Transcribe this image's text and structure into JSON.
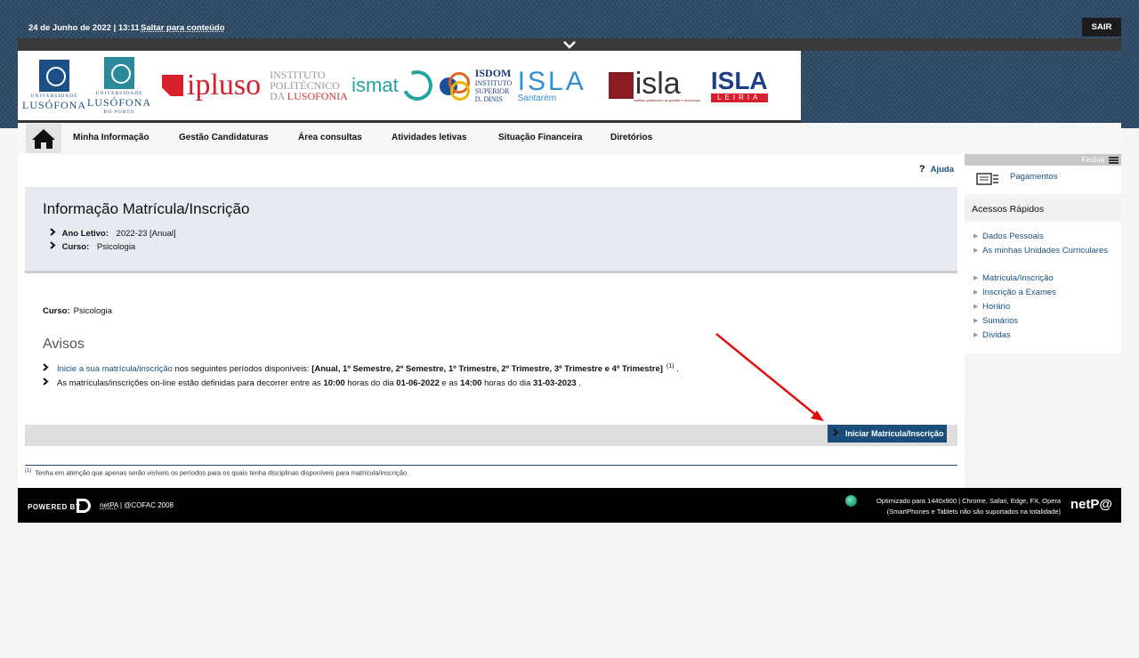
{
  "topbar": {
    "date": "24 de Junho de 2022 | 13:11",
    "skip_link": "Saltar para conteúdo",
    "logout": "SAIR"
  },
  "logos": {
    "ul_small": "UNIVERSIDADE",
    "ul_big": "LUSÓFONA",
    "ulp_small": "UNIVERSIDADE",
    "ulp_big": "LUSÓFONA",
    "ulp_sub": "DO PORTO",
    "ipluso": "ipluso",
    "ipl_line1": "INSTITUTO",
    "ipl_line2": "POLITÉCNICO",
    "ipl_line3": "DA",
    "ipl_line4": "LUSOFONIA",
    "ismat": "ismat",
    "isdom_title": "ISDOM",
    "isdom_line1": "INSTITUTO",
    "isdom_line2": "SUPERIOR",
    "isdom_line3": "D. DINIS",
    "isla_santarem": "ISLA",
    "isla_santarem_sub": "Santarém",
    "isla_gestao": "isla",
    "isla_gestao_sub": "instituto politécnico de gestão e tecnologia",
    "isla_leiria": "ISLA",
    "isla_leiria_sub": "LEIRIA"
  },
  "nav": {
    "items": [
      "Minha Informação",
      "Gestão Candidaturas",
      "Área consultas",
      "Atividades letivas",
      "Situação Financeira",
      "Diretórios"
    ]
  },
  "help": "Ajuda",
  "info": {
    "title": "Informação Matrícula/Inscrição",
    "ano_label": "Ano Letivo:",
    "ano_value": "2022-23 [Anual]",
    "curso_label": "Curso:",
    "curso_value": "Psicologia"
  },
  "curso_line": {
    "label": "Curso:",
    "value": "Psicologia"
  },
  "avisos": {
    "title": "Avisos",
    "item1_link": "Inicie a sua matrícula/inscrição",
    "item1_text": " nos seguintes períodos disponíveis: ",
    "item1_periods": "[Anual, 1º Semestre, 2º Semestre, 1º Trimestre, 2º Trimestre, 3º Trimestre e 4º Trimestre]",
    "item1_sup": "(1)",
    "item1_end": ".",
    "item2_a": "As matrículas/inscrições on-line estão definidas para decorrer entre as ",
    "item2_t1": "10:00",
    "item2_b": " horas do dia ",
    "item2_d1": "01-06-2022",
    "item2_c": " e as ",
    "item2_t2": "14:00",
    "item2_d": " horas do dia ",
    "item2_d2": "31-03-2023",
    "item2_end": " ."
  },
  "action": {
    "button": "Iniciar Matrícula/Inscrição"
  },
  "footnote": {
    "sup": "(1)",
    "text": "Tenha em atenção que apenas serão visíveis os períodos para os quais tenha disciplinas disponíveis para matrícula/inscrição."
  },
  "sidebar": {
    "close": "Fechar",
    "payments": "Pagamentos",
    "quick_title": "Acessos Rápidos",
    "links": [
      "Dados Pessoais",
      "As minhas Unidades Curriculares",
      "Matrícula/Inscrição",
      "Inscrição a Exames",
      "Horário",
      "Sumários",
      "Dívidas"
    ]
  },
  "footer": {
    "powered": "POWERED BY",
    "netpa": "netPA",
    "copyright": " | @COFAC 2008",
    "optimized": "Optimizado para 1440x900 | Chrome, Safari, Edge, FX, Opera",
    "mobile": "(SmartPhones e Tablets não são suportados na totalidade)",
    "brand": "netP@"
  },
  "colors": {
    "accent": "#1a4d7a",
    "header_bg": "#2e4a66",
    "annotation_arrow": "#e01010"
  }
}
